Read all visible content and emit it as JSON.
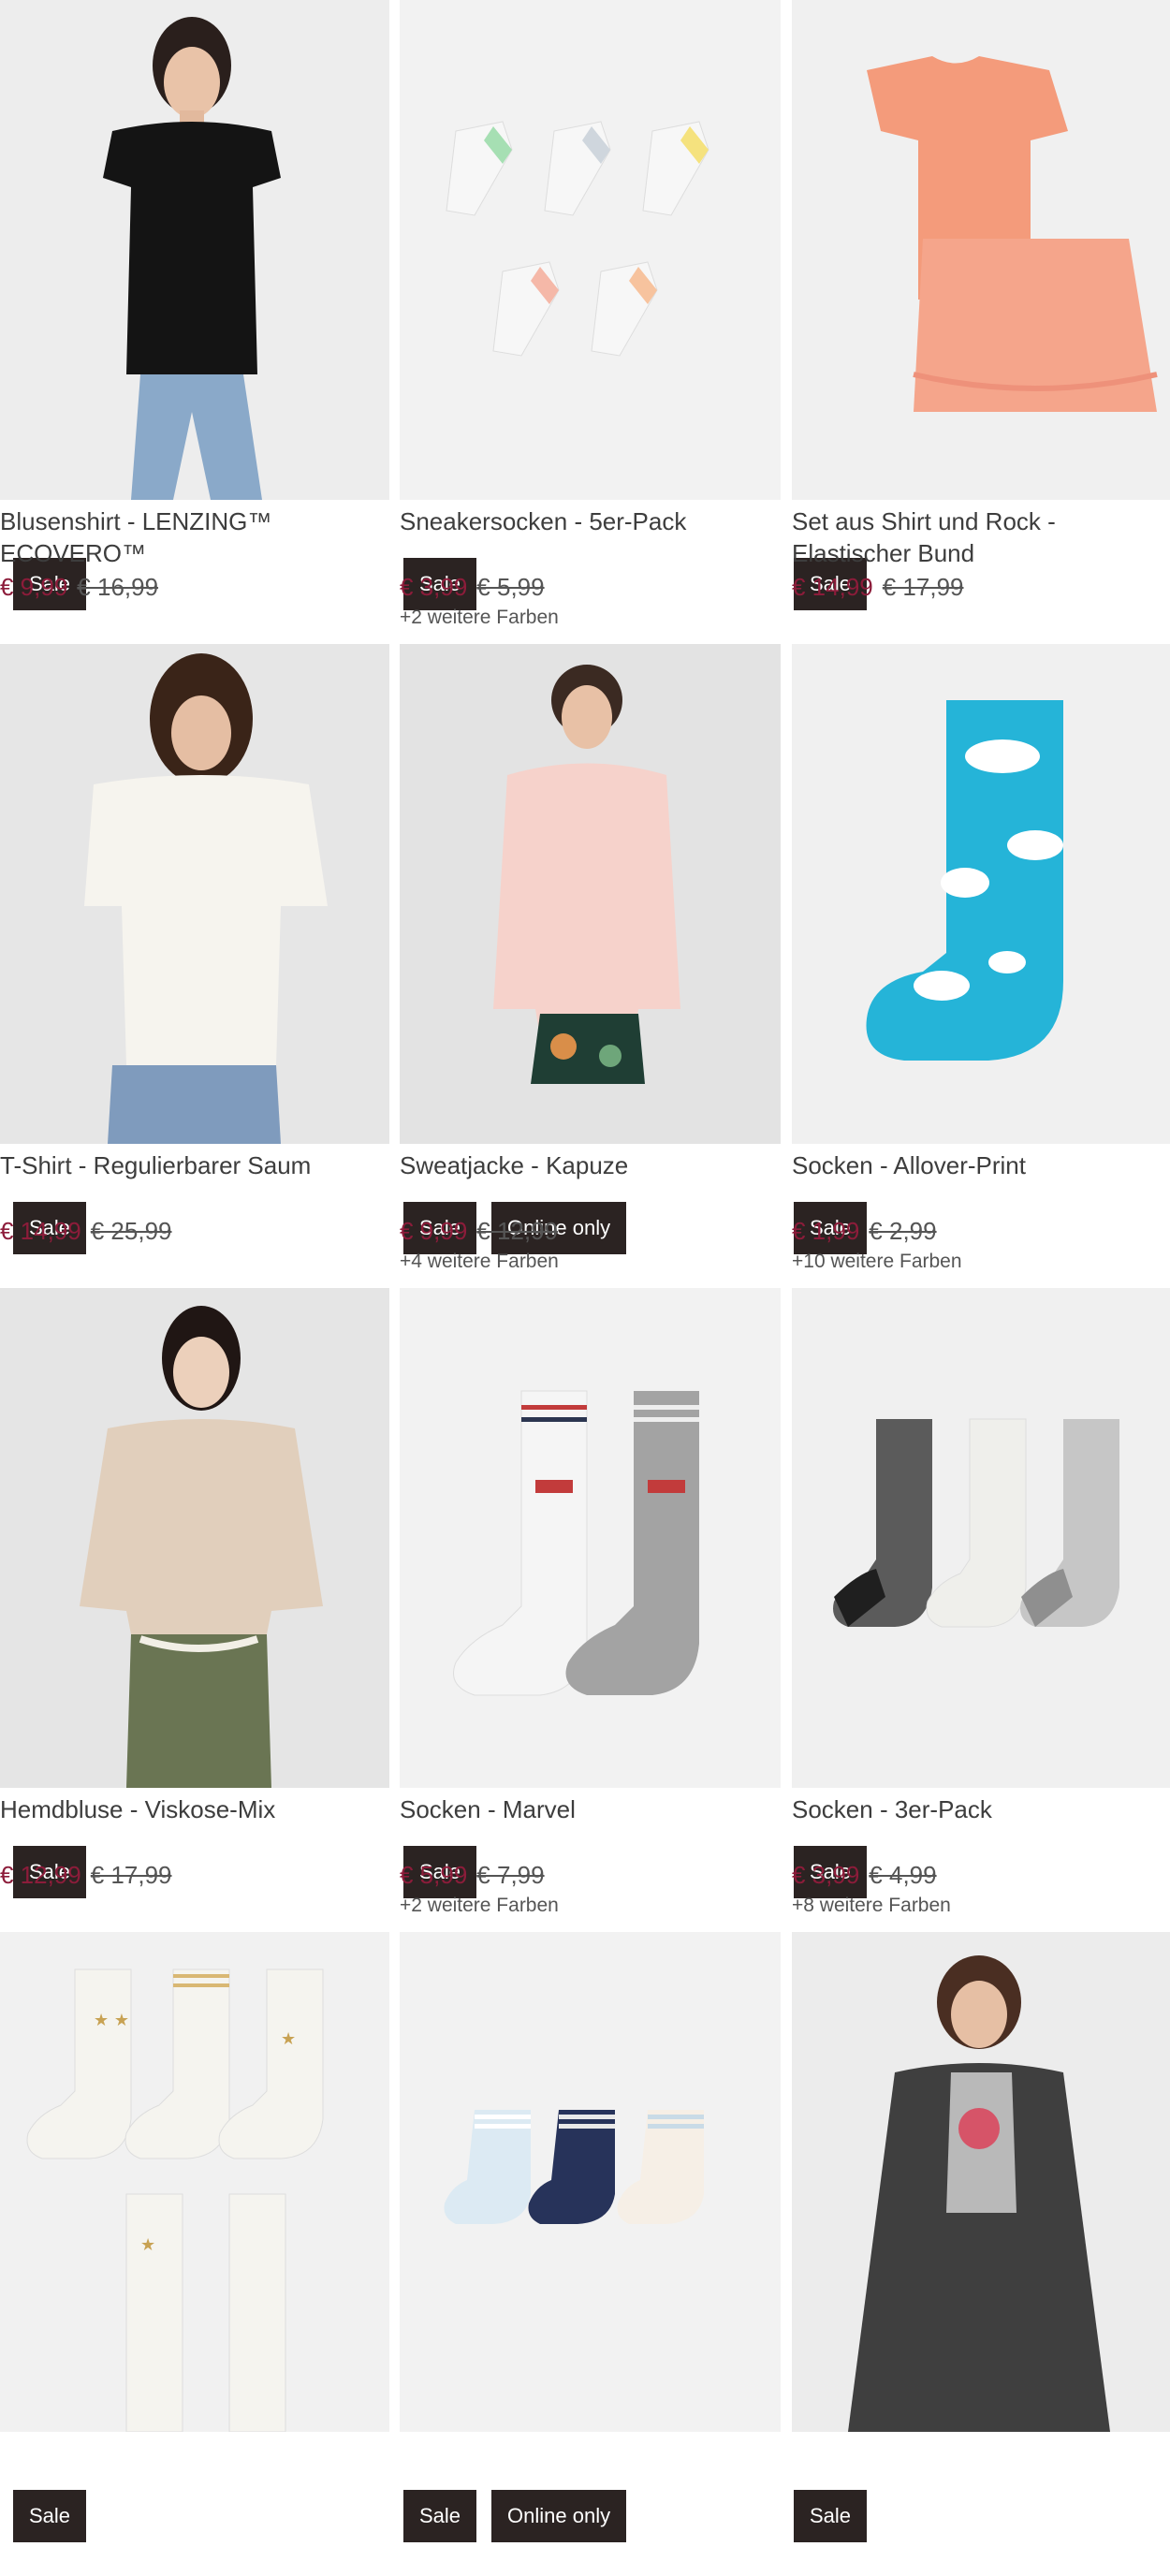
{
  "products": [
    {
      "title": "Blusenshirt - LENZING™ ECOVERO™",
      "price": "€ 9,99",
      "old_price": "€ 16,99",
      "colors": "",
      "badges": [
        "Sale"
      ],
      "image": "woman-black-blouse"
    },
    {
      "title": "Sneakersocken - 5er-Pack",
      "price": "€ 3,99",
      "old_price": "€ 5,99",
      "colors": "+2 weitere Farben",
      "badges": [
        "Sale"
      ],
      "image": "pastel-ankle-socks"
    },
    {
      "title": "Set aus Shirt und Rock - Elastischer Bund",
      "price": "€ 14,99",
      "old_price": "€ 17,99",
      "colors": "",
      "badges": [
        "Sale"
      ],
      "image": "coral-shirt-skirt-set"
    },
    {
      "title": "T-Shirt - Regulierbarer Saum",
      "price": "€ 14,99",
      "old_price": "€ 25,99",
      "colors": "",
      "badges": [
        "Sale"
      ],
      "image": "woman-white-tshirt"
    },
    {
      "title": "Sweatjacke - Kapuze",
      "price": "€ 9,99",
      "old_price": "€ 12,99",
      "colors": "+4 weitere Farben",
      "badges": [
        "Sale",
        "Online only"
      ],
      "image": "woman-pink-hoodie"
    },
    {
      "title": "Socken - Allover-Print",
      "price": "€ 1,99",
      "old_price": "€ 2,99",
      "colors": "+10 weitere Farben",
      "badges": [
        "Sale"
      ],
      "image": "cloud-print-sock"
    },
    {
      "title": "Hemdbluse - Viskose-Mix",
      "price": "€ 12,99",
      "old_price": "€ 17,99",
      "colors": "",
      "badges": [
        "Sale"
      ],
      "image": "woman-beige-blouse"
    },
    {
      "title": "Socken - Marvel",
      "price": "€ 5,99",
      "old_price": "€ 7,99",
      "colors": "+2 weitere Farben",
      "badges": [
        "Sale"
      ],
      "image": "marvel-socks"
    },
    {
      "title": "Socken - 3er-Pack",
      "price": "€ 3,99",
      "old_price": "€ 4,99",
      "colors": "+8 weitere Farben",
      "badges": [
        "Sale"
      ],
      "image": "herringbone-socks"
    },
    {
      "title": "",
      "price": "",
      "old_price": "",
      "colors": "",
      "badges": [
        "Sale"
      ],
      "image": "star-socks"
    },
    {
      "title": "",
      "price": "",
      "old_price": "",
      "colors": "",
      "badges": [
        "Sale",
        "Online only"
      ],
      "image": "kids-striped-socks"
    },
    {
      "title": "",
      "price": "",
      "old_price": "",
      "colors": "",
      "badges": [
        "Sale"
      ],
      "image": "woman-grey-cardigan"
    }
  ]
}
